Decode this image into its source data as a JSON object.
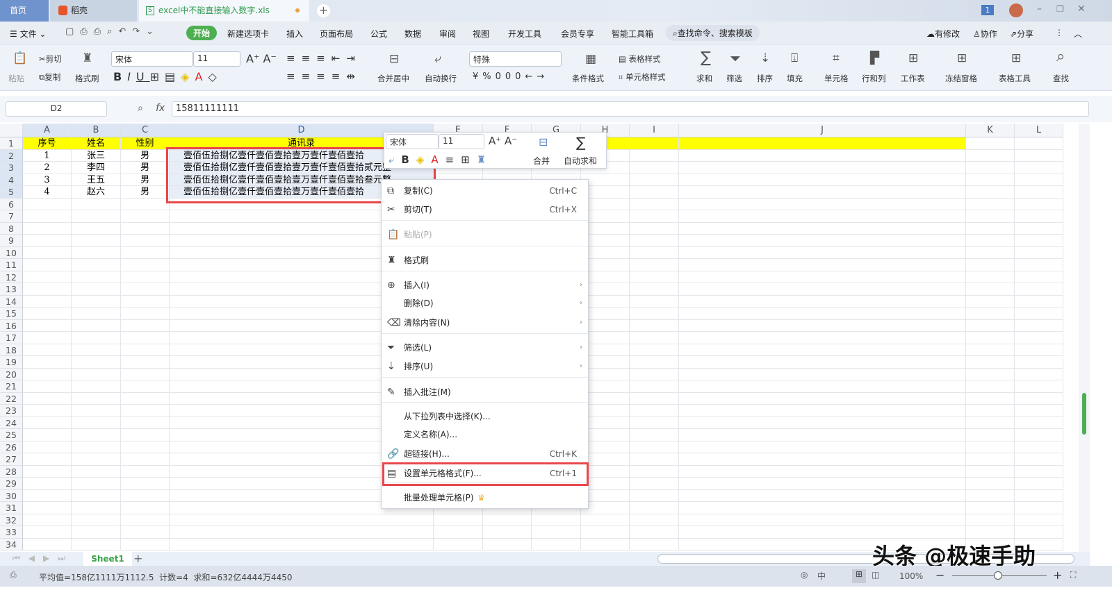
{
  "tabs": {
    "home": "首页",
    "docer": "稻壳",
    "file": "excel中不能直接输入数字.xls",
    "notif_count": "1"
  },
  "menu": {
    "file": "文件",
    "items": [
      "开始",
      "新建选项卡",
      "插入",
      "页面布局",
      "公式",
      "数据",
      "审阅",
      "视图",
      "开发工具",
      "会员专享",
      "智能工具箱"
    ],
    "search": "查找命令、搜索模板",
    "modified": "有修改",
    "collab": "协作",
    "share": "分享"
  },
  "ribbon": {
    "paste": "粘贴",
    "cut": "剪切",
    "copy": "复制",
    "format_painter": "格式刷",
    "font": "宋体",
    "size": "11",
    "merge": "合并居中",
    "wrap": "自动换行",
    "numfmt": "特殊",
    "cond_fmt": "条件格式",
    "table_style": "表格样式",
    "cell_style": "单元格样式",
    "sum": "求和",
    "filter": "筛选",
    "sort": "排序",
    "fill": "填充",
    "cell": "单元格",
    "rowcol": "行和列",
    "sheet": "工作表",
    "freeze": "冻结窗格",
    "tools": "表格工具",
    "find": "查找"
  },
  "formula": {
    "name_box": "D2",
    "fx": "fx",
    "value": "15811111111"
  },
  "columns": [
    "A",
    "B",
    "C",
    "D",
    "E",
    "F",
    "G",
    "H",
    "I",
    "J",
    "K",
    "L"
  ],
  "rows": [
    [
      "序号",
      "姓名",
      "性别",
      "通讯录"
    ],
    [
      "1",
      "张三",
      "男",
      "壹佰伍拾捌亿壹仟壹佰壹拾壹万壹仟壹佰壹拾"
    ],
    [
      "2",
      "李四",
      "男",
      "壹佰伍拾捌亿壹仟壹佰壹拾壹万壹仟壹佰壹拾贰元整"
    ],
    [
      "3",
      "王五",
      "男",
      "壹佰伍拾捌亿壹仟壹佰壹拾壹万壹仟壹佰壹拾叁元整"
    ],
    [
      "4",
      "赵六",
      "男",
      "壹佰伍拾捌亿壹仟壹佰壹拾壹万壹仟壹佰壹拾"
    ]
  ],
  "row_count": 34,
  "mini_toolbar": {
    "font": "宋体",
    "size": "11",
    "merge": "合并",
    "autosum": "自动求和"
  },
  "context_menu": [
    {
      "label": "复制(C)",
      "shortcut": "Ctrl+C",
      "icon": "copy"
    },
    {
      "label": "剪切(T)",
      "shortcut": "Ctrl+X",
      "icon": "cut"
    },
    {
      "label": "粘贴(P)",
      "icon": "paste",
      "disabled": true
    },
    {
      "label": "格式刷",
      "icon": "format-painter"
    },
    {
      "label": "插入(I)",
      "icon": "insert",
      "submenu": true
    },
    {
      "label": "删除(D)",
      "submenu": true
    },
    {
      "label": "清除内容(N)",
      "icon": "clear",
      "submenu": true
    },
    {
      "label": "筛选(L)",
      "icon": "filter",
      "submenu": true
    },
    {
      "label": "排序(U)",
      "icon": "sort",
      "submenu": true
    },
    {
      "label": "插入批注(M)",
      "icon": "comment"
    },
    {
      "label": "从下拉列表中选择(K)..."
    },
    {
      "label": "定义名称(A)..."
    },
    {
      "label": "超链接(H)...",
      "shortcut": "Ctrl+K",
      "icon": "link"
    },
    {
      "label": "设置单元格格式(F)...",
      "shortcut": "Ctrl+1",
      "icon": "format-cells"
    },
    {
      "label": "批量处理单元格(P)",
      "icon": "crown"
    }
  ],
  "sheet": {
    "name": "Sheet1"
  },
  "status": {
    "text": "平均值=158亿1111万1112.5  计数=4  求和=632亿4444万4450",
    "zoom": "100%"
  },
  "watermark": "头条 @极速手助",
  "colors": {
    "accent": "#4caf50",
    "highlight": "#ffff00",
    "red": "#e8474b"
  }
}
